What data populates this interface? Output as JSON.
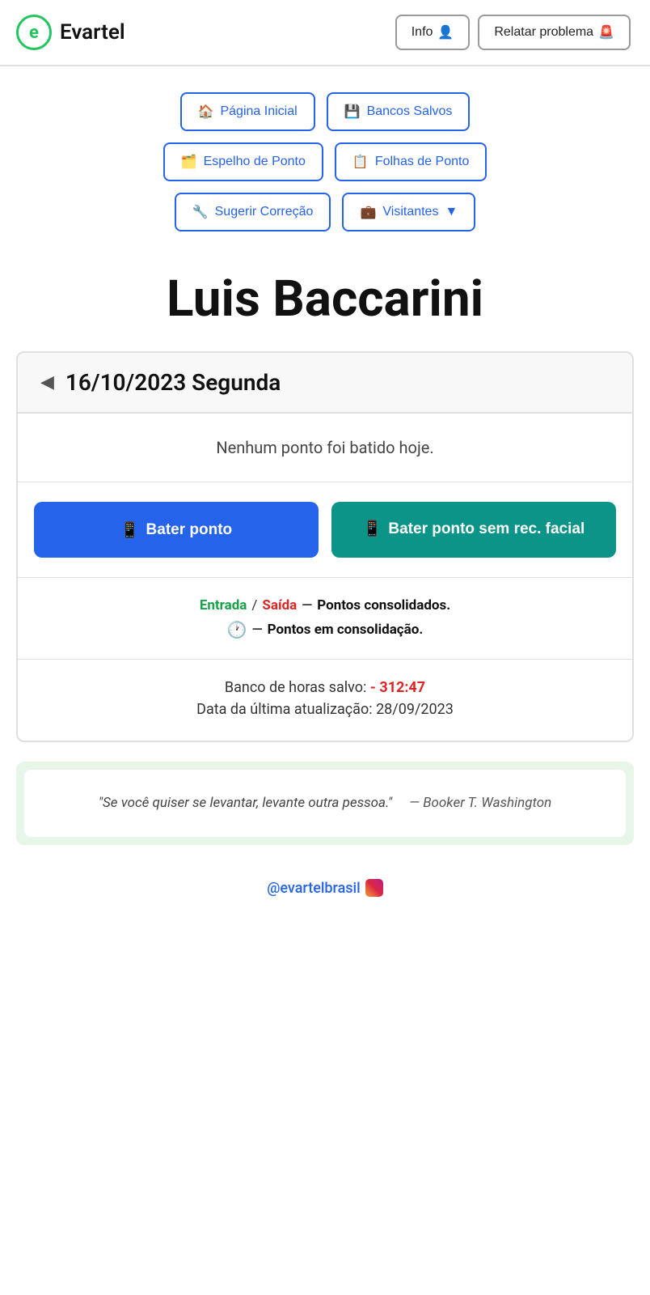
{
  "header": {
    "logo_letter": "e",
    "app_name": "Evartel",
    "info_label": "Info",
    "info_icon": "👤",
    "report_label": "Relatar problema",
    "report_icon": "🚨"
  },
  "nav": {
    "pagina_inicial_icon": "🏠",
    "pagina_inicial_label": "Página Inicial",
    "bancos_salvos_icon": "💾",
    "bancos_salvos_label": "Bancos Salvos",
    "espelho_icon": "🗂️",
    "espelho_label": "Espelho de Ponto",
    "folhas_icon": "📋",
    "folhas_label": "Folhas de Ponto",
    "sugerir_icon": "🔧",
    "sugerir_label": "Sugerir Correção",
    "visitantes_icon": "💼",
    "visitantes_label": "Visitantes",
    "visitantes_arrow": "▼"
  },
  "user": {
    "name": "Luis Baccarini"
  },
  "date_section": {
    "arrow_left": "◀",
    "date_text": "16/10/2023 Segunda"
  },
  "punch_section": {
    "no_punch_text": "Nenhum ponto foi batido hoje.",
    "btn_bater_icon": "📱",
    "btn_bater_label": "Bater ponto",
    "btn_bater_sem_icon": "📱",
    "btn_bater_sem_label": "Bater ponto sem rec. facial"
  },
  "legend": {
    "entrada_text": "Entrada",
    "separator": "/",
    "saida_text": "Saída",
    "dash": "—",
    "consolidated_text": "Pontos consolidados.",
    "clock_icon": "🕐",
    "dash2": "—",
    "consolidating_text": "Pontos em consolidação."
  },
  "bank": {
    "banco_label": "Banco de horas salvo:",
    "banco_value": "- 312:47",
    "atualizacao_label": "Data da última atualização:",
    "atualizacao_value": "28/09/2023"
  },
  "quote": {
    "text": "\"Se você quiser se levantar, levante outra pessoa.\"",
    "author": "— Booker T. Washington"
  },
  "footer": {
    "instagram_handle": "@evartelbrasil"
  }
}
